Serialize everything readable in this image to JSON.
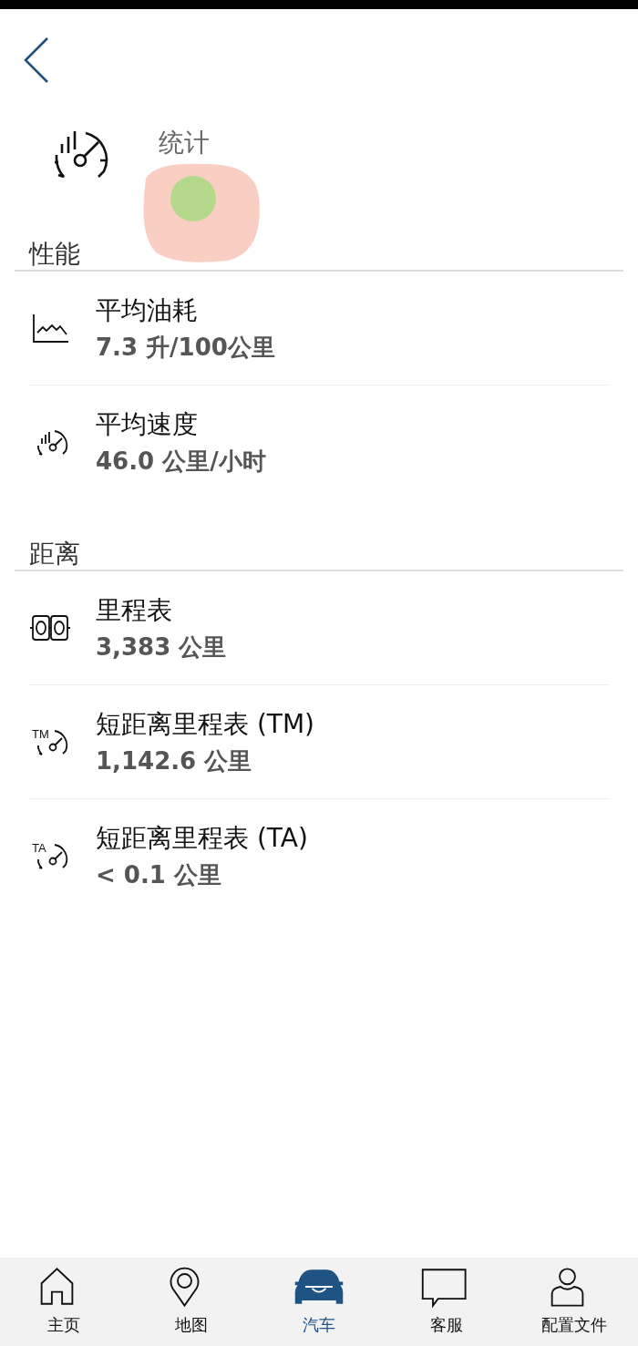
{
  "header": {
    "title": "统计"
  },
  "sections": [
    {
      "title": "性能",
      "items": [
        {
          "kind": "chart",
          "label": "平均油耗",
          "value": "7.3 升/100公里"
        },
        {
          "kind": "gauge",
          "label": "平均速度",
          "value": "46.0 公里/小时"
        }
      ]
    },
    {
      "title": "距离",
      "items": [
        {
          "kind": "odometer",
          "label": "里程表",
          "value": "3,383 公里"
        },
        {
          "kind": "gauge",
          "icon_text": "TM",
          "label": "短距离里程表 (TM)",
          "value": "1,142.6 公里"
        },
        {
          "kind": "gauge",
          "icon_text": "TA",
          "label": "短距离里程表 (TA)",
          "value": "< 0.1 公里"
        }
      ]
    }
  ],
  "tabs": [
    {
      "label": "主页",
      "selected": false
    },
    {
      "label": "地图",
      "selected": false
    },
    {
      "label": "汽车",
      "selected": true
    },
    {
      "label": "客服",
      "selected": false
    },
    {
      "label": "配置文件",
      "selected": false
    }
  ]
}
